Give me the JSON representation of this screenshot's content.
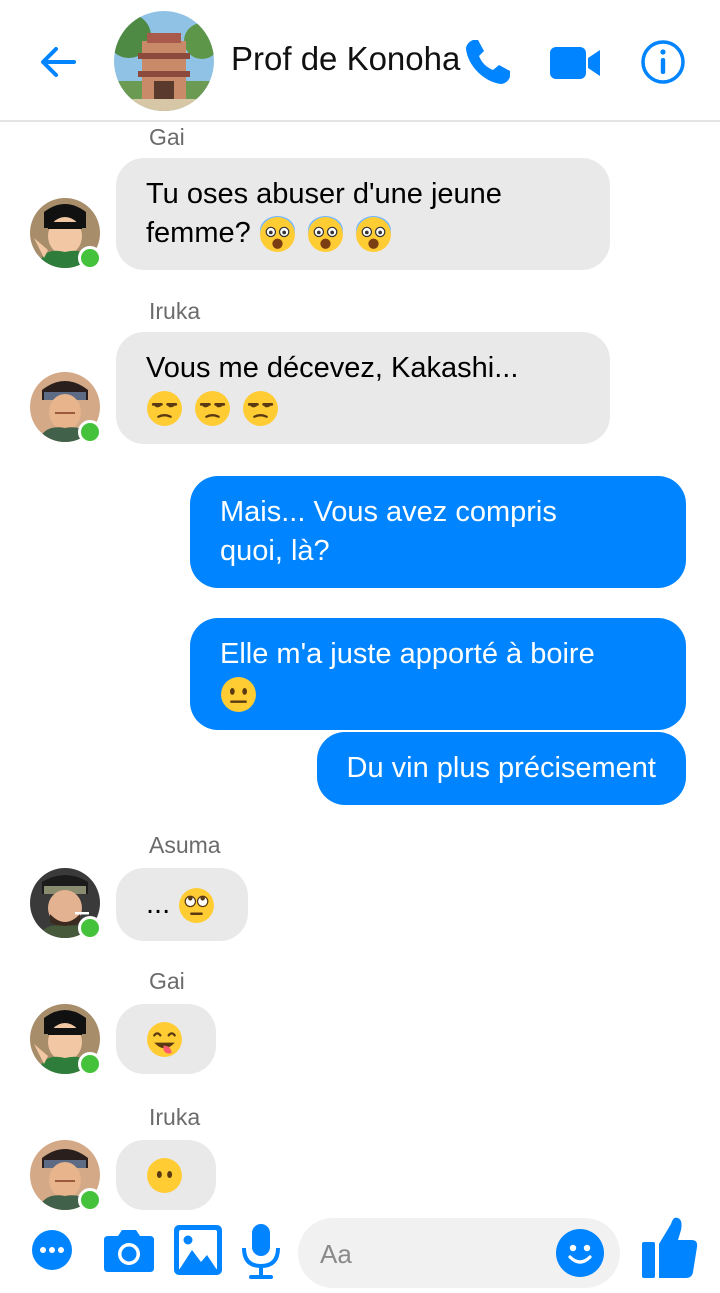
{
  "header": {
    "title": "Prof de Konoha",
    "icons": [
      "back-arrow-icon",
      "group-avatar",
      "phone-icon",
      "video-camera-icon",
      "info-icon"
    ],
    "accent_color": "#0084ff"
  },
  "messages": [
    {
      "sender": "Gai",
      "text": "Tu oses abuser d'une jeune",
      "text2": "femme?",
      "emoji": "fearful-face"
    },
    {
      "sender": "Iruka",
      "text": "Vous me décevez, Kakashi...",
      "emoji": "unamused-face"
    },
    {
      "outgoing": true,
      "line1": "Mais... Vous avez compris",
      "line2": "quoi, là?"
    },
    {
      "outgoing": true,
      "line1": "Elle m'a juste apporté à boire",
      "emoji": "neutral-face"
    },
    {
      "outgoing": true,
      "line1": "Du vin plus précisement"
    },
    {
      "sender": "Asuma",
      "text": "...",
      "emoji": "eye-roll-face"
    },
    {
      "sender": "Gai",
      "emoji": "face-savoring-food"
    },
    {
      "sender": "Iruka",
      "emoji": "face-without-mouth"
    }
  ],
  "composer": {
    "placeholder": "Aa",
    "icons": [
      "more-icon",
      "camera-icon",
      "image-icon",
      "microphone-icon",
      "emoji-icon",
      "thumbs-up-icon"
    ]
  },
  "colors": {
    "outgoing_bubble": "#0084ff",
    "incoming_bubble": "#e9e9e9",
    "online_dot": "#44c23b"
  }
}
